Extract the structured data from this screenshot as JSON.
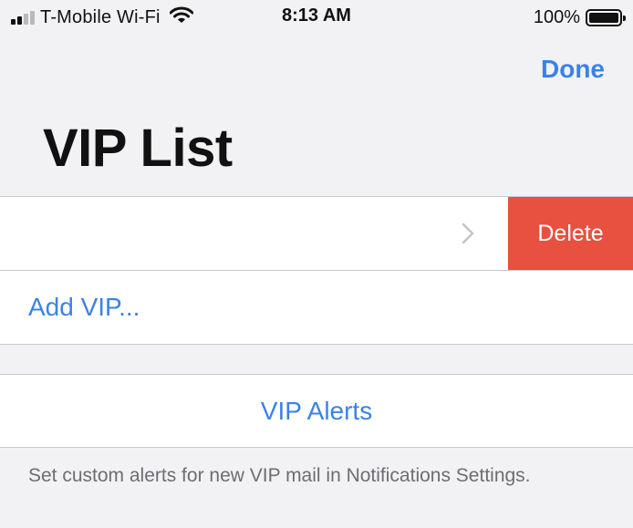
{
  "status_bar": {
    "carrier": "T-Mobile Wi-Fi",
    "signal_bars_active": 2,
    "signal_bars_total": 4,
    "time": "8:13 AM",
    "battery_percent": "100%"
  },
  "nav": {
    "done_label": "Done",
    "title": "VIP List"
  },
  "vip_list": {
    "row": {
      "delete_label": "Delete"
    },
    "add_label": "Add VIP..."
  },
  "alerts": {
    "label": "VIP Alerts",
    "footer": "Set custom alerts for new VIP mail in Notifications Settings."
  },
  "colors": {
    "accent": "#3b82e6",
    "destructive": "#e8503f",
    "background": "#f2f2f4",
    "separator": "#c8c8cc",
    "secondary_text": "#6d6d72"
  },
  "icons": [
    "signal-bars-icon",
    "wifi-icon",
    "battery-icon",
    "chevron-right-icon"
  ]
}
